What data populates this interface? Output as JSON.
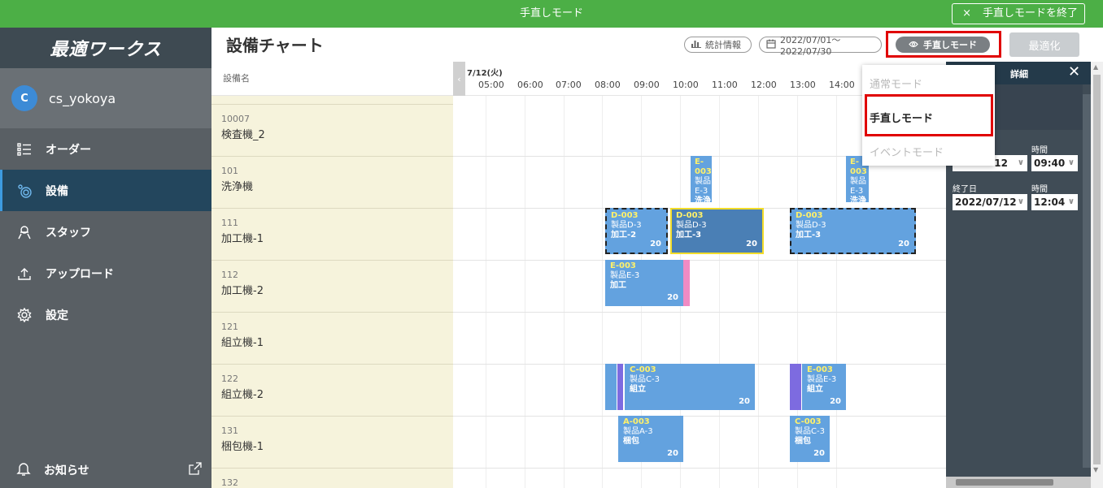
{
  "banner": {
    "title": "手直しモード",
    "end_label": "手直しモードを終了",
    "end_icon": "×"
  },
  "sidebar": {
    "logo": "最適ワークス",
    "user": {
      "initial": "C",
      "name": "cs_yokoya"
    },
    "items": [
      {
        "label": "オーダー",
        "icon": "list-icon"
      },
      {
        "label": "設備",
        "icon": "gear-cog-icon"
      },
      {
        "label": "スタッフ",
        "icon": "person-icon"
      },
      {
        "label": "アップロード",
        "icon": "upload-icon"
      },
      {
        "label": "設定",
        "icon": "settings-icon"
      }
    ],
    "notice": {
      "label": "お知らせ",
      "icon": "bell-icon"
    }
  },
  "header": {
    "title": "設備チャート",
    "stats_label": "統計情報",
    "range_label": "2022/07/01〜2022/07/30",
    "mode_label": "手直しモード",
    "optimize_label": "最適化"
  },
  "equipment": {
    "header": "設備名",
    "rows": [
      {
        "code": "10007",
        "name": "検査機_2"
      },
      {
        "code": "101",
        "name": "洗浄機"
      },
      {
        "code": "111",
        "name": "加工機-1"
      },
      {
        "code": "112",
        "name": "加工機-2"
      },
      {
        "code": "121",
        "name": "組立機-1"
      },
      {
        "code": "122",
        "name": "組立機-2"
      },
      {
        "code": "131",
        "name": "梱包機-1"
      },
      {
        "code": "132",
        "name": ""
      }
    ]
  },
  "timeline": {
    "date": "7/12(火)",
    "hours": [
      "05:00",
      "06:00",
      "07:00",
      "08:00",
      "09:00",
      "10:00",
      "11:00",
      "12:00",
      "13:00",
      "14:00"
    ]
  },
  "tasks": [
    {
      "code": "E-003",
      "product": "製品E-3",
      "op": "洗浄",
      "qty": ""
    },
    {
      "code": "E-003",
      "product": "製品E-3",
      "op": "洗浄",
      "qty": ""
    },
    {
      "code": "D-003",
      "product": "製品D-3",
      "op": "加工-2",
      "qty": "20"
    },
    {
      "code": "D-003",
      "product": "製品D-3",
      "op": "加工-3",
      "qty": "20"
    },
    {
      "code": "D-003",
      "product": "製品D-3",
      "op": "加工-3",
      "qty": "20"
    },
    {
      "code": "E-003",
      "product": "製品E-3",
      "op": "加工",
      "qty": "20"
    },
    {
      "code": "C-003",
      "product": "製品C-3",
      "op": "組立",
      "qty": "20"
    },
    {
      "code": "E-003",
      "product": "製品E-3",
      "op": "組立",
      "qty": "20"
    },
    {
      "code": "A-003",
      "product": "製品A-3",
      "op": "梱包",
      "qty": "20"
    },
    {
      "code": "C-003",
      "product": "製品C-3",
      "op": "梱包",
      "qty": "20"
    }
  ],
  "mode_menu": {
    "items": [
      "通常モード",
      "手直しモード",
      "イベントモード"
    ]
  },
  "detail": {
    "title": "詳細",
    "start_time_label": "時間",
    "start_date_value": "12",
    "start_time_value": "09:40",
    "end_date_label": "終了日",
    "end_time_label": "時間",
    "end_date_value": "2022/07/12",
    "end_time_value": "12:04"
  }
}
